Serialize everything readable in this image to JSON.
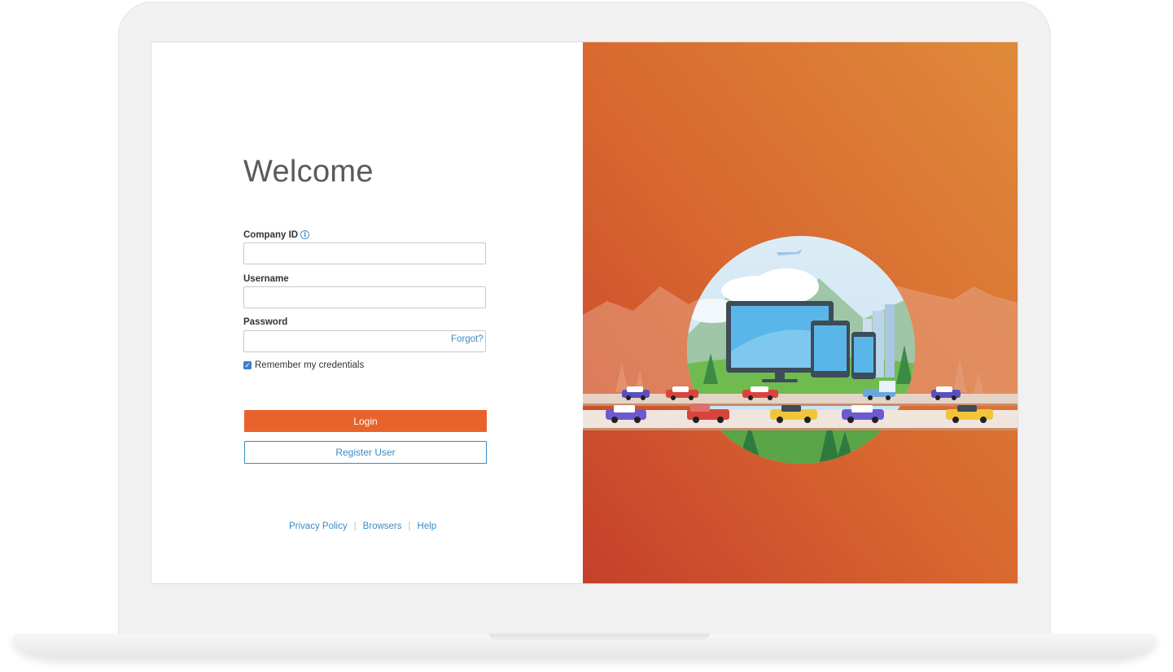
{
  "login": {
    "title": "Welcome",
    "company_id_label": "Company ID",
    "username_label": "Username",
    "password_label": "Password",
    "forgot_label": "Forgot?",
    "remember_label": "Remember my credentials",
    "remember_checked": true,
    "login_label": "Login",
    "register_label": "Register User"
  },
  "footer": {
    "links": [
      "Privacy Policy",
      "Browsers",
      "Help"
    ]
  },
  "illustration": {
    "subject": "devices-traffic-landscape",
    "colors": {
      "bg_top": "#df8a3a",
      "bg_bottom": "#c8442c",
      "accent": "#e8632b",
      "link": "#3a8cc4"
    }
  }
}
